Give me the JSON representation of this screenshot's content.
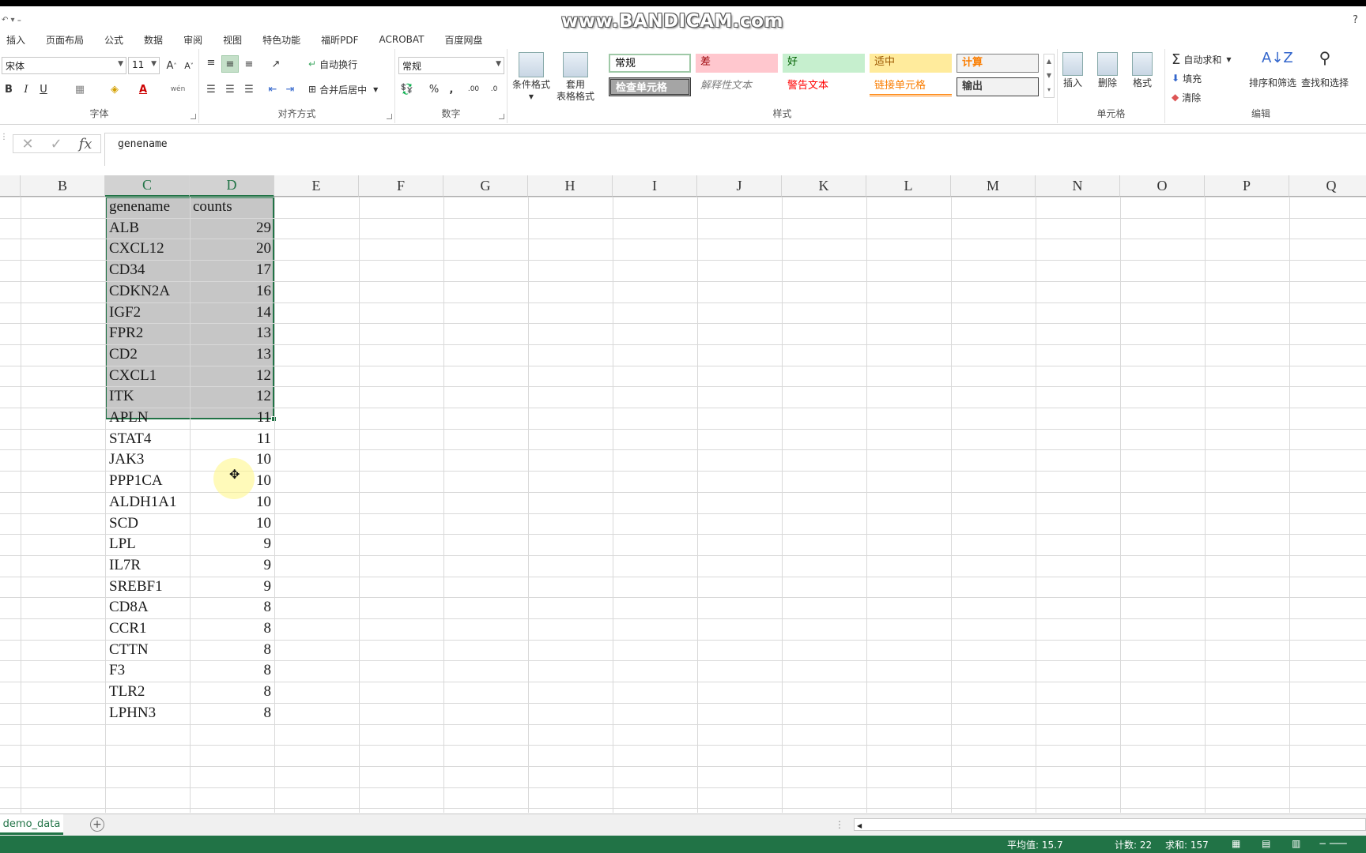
{
  "watermark": "www.BANDICAM.com",
  "tabs": [
    "插入",
    "页面布局",
    "公式",
    "数据",
    "审阅",
    "视图",
    "特色功能",
    "福昕PDF",
    "ACROBAT",
    "百度网盘"
  ],
  "ribbon": {
    "font": {
      "name": "宋体",
      "size": "11",
      "group_label": "字体"
    },
    "align": {
      "wrap_label": "自动换行",
      "merge_label": "合并后居中",
      "group_label": "对齐方式"
    },
    "number": {
      "format": "常规",
      "group_label": "数字"
    },
    "styles": {
      "cond_format": "条件格式",
      "table_format_1": "套用",
      "table_format_2": "表格格式",
      "cells": [
        "常规",
        "差",
        "好",
        "适中",
        "计算",
        "检查单元格",
        "解释性文本",
        "警告文本",
        "链接单元格",
        "输出"
      ],
      "group_label": "样式"
    },
    "cells_group": {
      "insert": "插入",
      "delete": "删除",
      "format": "格式",
      "group_label": "单元格"
    },
    "editing": {
      "autosum": "自动求和",
      "fill": "填充",
      "clear": "清除",
      "sort_filter": "排序和筛选",
      "find_select": "查找和选择",
      "group_label": "编辑"
    }
  },
  "formula_bar": {
    "value": "genename"
  },
  "columns": [
    "B",
    "C",
    "D",
    "E",
    "F",
    "G",
    "H",
    "I",
    "J",
    "K",
    "L",
    "M",
    "N",
    "O",
    "P",
    "Q"
  ],
  "table": {
    "header": {
      "name": "genename",
      "count": "counts"
    },
    "rows": [
      {
        "name": "ALB",
        "count": "29"
      },
      {
        "name": "CXCL12",
        "count": "20"
      },
      {
        "name": "CD34",
        "count": "17"
      },
      {
        "name": "CDKN2A",
        "count": "16"
      },
      {
        "name": "IGF2",
        "count": "14"
      },
      {
        "name": "FPR2",
        "count": "13"
      },
      {
        "name": "CD2",
        "count": "13"
      },
      {
        "name": "CXCL1",
        "count": "12"
      },
      {
        "name": "ITK",
        "count": "12"
      },
      {
        "name": "APLN",
        "count": "11"
      },
      {
        "name": "STAT4",
        "count": "11"
      },
      {
        "name": "JAK3",
        "count": "10"
      },
      {
        "name": "PPP1CA",
        "count": "10"
      },
      {
        "name": "ALDH1A1",
        "count": "10"
      },
      {
        "name": "SCD",
        "count": "10"
      },
      {
        "name": "LPL",
        "count": "9"
      },
      {
        "name": "IL7R",
        "count": "9"
      },
      {
        "name": "SREBF1",
        "count": "9"
      },
      {
        "name": "CD8A",
        "count": "8"
      },
      {
        "name": "CCR1",
        "count": "8"
      },
      {
        "name": "CTTN",
        "count": "8"
      },
      {
        "name": "F3",
        "count": "8"
      },
      {
        "name": "TLR2",
        "count": "8"
      },
      {
        "name": "LPHN3",
        "count": "8"
      }
    ]
  },
  "sheet_tab": "demo_data",
  "status": {
    "average": "平均值: 15.7",
    "count": "计数: 22",
    "sum": "求和: 157"
  },
  "colors": {
    "accent": "#217346",
    "selection_fill": "#c6c6c6"
  }
}
